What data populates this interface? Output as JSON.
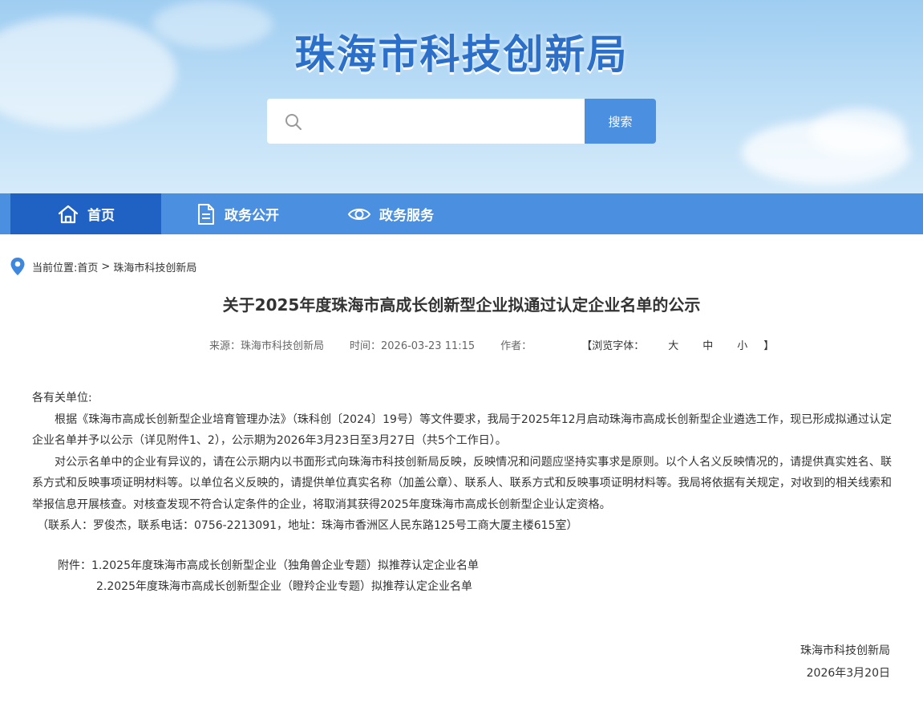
{
  "header": {
    "site_title": "珠海市科技创新局",
    "search": {
      "placeholder": "",
      "button_label": "搜索"
    }
  },
  "nav": {
    "items": [
      {
        "label": "首页",
        "icon": "home-icon",
        "active": true
      },
      {
        "label": "政务公开",
        "icon": "document-icon",
        "active": false
      },
      {
        "label": "政务服务",
        "icon": "eye-icon",
        "active": false
      }
    ]
  },
  "breadcrumb": {
    "prefix": "当前位置:",
    "home": "首页",
    "separator": ">",
    "current": "珠海市科技创新局"
  },
  "article": {
    "title": "关于2025年度珠海市高成长创新型企业拟通过认定企业名单的公示",
    "meta": {
      "source": "来源：珠海市科技创新局",
      "time": "时间：2026-03-23 11:15",
      "author": "作者：",
      "font_label": "【浏览字体：",
      "size_large": "大",
      "size_medium": "中",
      "size_small": "小",
      "bracket_end": "】"
    },
    "greeting": "各有关单位:",
    "paragraphs": [
      "根据《珠海市高成长创新型企业培育管理办法》（珠科创〔2024〕19号）等文件要求，我局于2025年12月启动珠海市高成长创新型企业遴选工作，现已形成拟通过认定企业名单并予以公示（详见附件1、2），公示期为2026年3月23日至3月27日（共5个工作日）。",
      "对公示名单中的企业有异议的，请在公示期内以书面形式向珠海市科技创新局反映，反映情况和问题应坚持实事求是原则。以个人名义反映情况的，请提供真实姓名、联系方式和反映事项证明材料等。以单位名义反映的，请提供单位真实名称（加盖公章）、联系人、联系方式和反映事项证明材料等。我局将依据有关规定，对收到的相关线索和举报信息开展核查。对核查发现不符合认定条件的企业，将取消其获得2025年度珠海市高成长创新型企业认定资格。"
    ],
    "contact": "（联系人：罗俊杰，联系电话：0756-2213091，地址：珠海市香洲区人民东路125号工商大厦主楼615室）",
    "attachments_label": "附件：",
    "attachments": [
      "1.2025年度珠海市高成长创新型企业（独角兽企业专题）拟推荐认定企业名单",
      "2.2025年度珠海市高成长创新型企业（瞪羚企业专题）拟推荐认定企业名单"
    ],
    "signature": {
      "org": "珠海市科技创新局",
      "date": "2026年3月20日"
    }
  },
  "colors": {
    "nav_bg": "#4b8fe1",
    "nav_active_bg": "#1f62c4",
    "search_button": "#4a8fe0",
    "title_blue": "#2b6fc9"
  }
}
